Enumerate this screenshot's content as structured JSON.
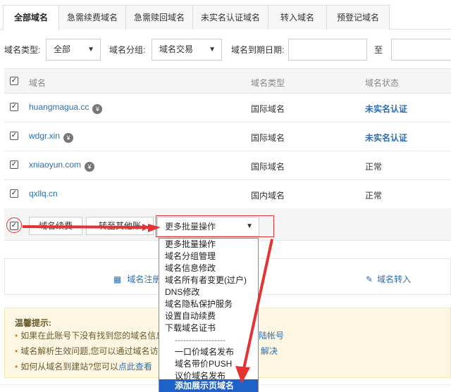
{
  "tabs": [
    {
      "label": "全部域名"
    },
    {
      "label": "急需续费域名"
    },
    {
      "label": "急需赎回域名"
    },
    {
      "label": "未实名认证域名"
    },
    {
      "label": "转入域名"
    },
    {
      "label": "预登记域名"
    }
  ],
  "filters": {
    "type_label": "域名类型:",
    "type_value": "全部",
    "group_label": "域名分组:",
    "group_value": "域名交易",
    "expiry_label": "域名到期日期:",
    "to_label": "至"
  },
  "table": {
    "headers": {
      "name": "域名",
      "type": "域名类型",
      "status": "域名状态"
    },
    "rows": [
      {
        "name": "huangmagua.cc",
        "type": "国际域名",
        "status": "未实名认证"
      },
      {
        "name": "wdgr.xin",
        "type": "国际域名",
        "status": "未实名认证"
      },
      {
        "name": "xniaoyun.com",
        "type": "国际域名",
        "status": "正常"
      },
      {
        "name": "qxllq.cn",
        "type": "国内域名",
        "status": "正常"
      }
    ]
  },
  "bulk": {
    "renew": "域名续费",
    "transfer": "转至其他账",
    "more": "更多批量操作"
  },
  "actions": {
    "register": "域名注册",
    "transfer_in": "域名转入"
  },
  "tips": {
    "title": "温馨提示:",
    "line1": "如果在此账号下没有找到您的域名信息,",
    "line1_link": "陆帐号",
    "line2": "域名解析生效问题,您可以通过域名访问",
    "line2_link": "解决",
    "line3": "如何从域名到建站?您可以",
    "line3_link": "点此查看"
  },
  "menu": {
    "items": [
      "更多批量操作",
      "域名分组管理",
      "域名信息修改",
      "域名所有者变更(过户)",
      "DNS修改",
      "域名隐私保护服务",
      "设置自动续费",
      "下载域名证书",
      "------------------",
      "一口价域名发布",
      "域名带价PUSH",
      "议价域名发布",
      "添加展示页域名"
    ]
  },
  "colors": {
    "link": "#2a6fb5",
    "annotation": "#e53333",
    "selected": "#1e62c9"
  },
  "icons": {
    "badge": "yuan-badge-icon",
    "calendar": "calendar-icon",
    "edit": "pencil-icon"
  }
}
